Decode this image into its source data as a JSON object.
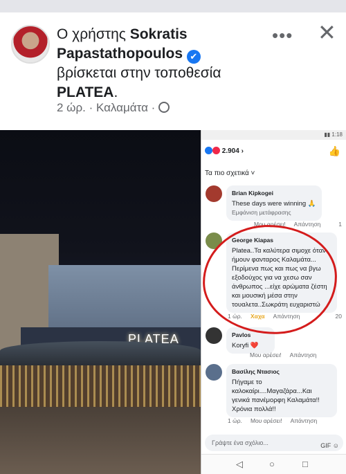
{
  "post": {
    "prefix": "Ο χρήστης ",
    "user_line1": "Sokratis",
    "user_line2": "Papastathopoulos",
    "verified_icon": "✔",
    "location_text": "βρίσκεται στην τοποθεσία",
    "location_name": "PLATEA",
    "time": "2 ώρ.",
    "place": "Καλαμάτα",
    "more_icon": "•••",
    "close_icon": "✕"
  },
  "photo": {
    "sign": "PLATEA"
  },
  "phone": {
    "reaction_count": "2.904",
    "reaction_arrow": "›",
    "sort_label": "Τα πιο σχετικά ˅",
    "comments": [
      {
        "name": "Brian Kipkogei",
        "text": "These days were winning 🙏",
        "sub": "Εμφάνιση μετάφρασης",
        "time": "",
        "like": "Μου αρέσει!",
        "reply": "Απάντηση",
        "count": "1"
      },
      {
        "name": "George Kiapas",
        "text": "Platea..Τα καλύτερα σιμοχε όταν ήμουν φανταρος Καλαμάτα... Περίμενα πως και πως να βγω εξοδούχος για να χεσω σαν άνθρωπος ...είχε αρώματα ζέστη και μουσική μέσα στην τουαλετα..Σωκράτη ευχαριστώ",
        "time": "1 ώρ.",
        "like": "Χαχα",
        "reply": "Απάντηση",
        "count": "20"
      },
      {
        "name": "Pavlos",
        "text": "Koryfi ❤️",
        "time": "",
        "like": "Μου αρέσει!",
        "reply": "Απάντηση",
        "count": ""
      },
      {
        "name": "Βασίλης Ντασιος",
        "text": "Πήγαμε το καλοκαίρι....Μαγαζάρα...Και γενικά πανέμορφη Καλαμάτα!! Χρόνια πολλά!!",
        "time": "1 ώρ.",
        "like": "Μου αρέσει!",
        "reply": "Απάντηση",
        "count": ""
      }
    ],
    "compose_placeholder": "Γράψτε ένα σχόλιο...",
    "compose_icons": "GIF ☺",
    "nav": [
      "◁",
      "○",
      "□"
    ]
  },
  "colors": {
    "accent": "#1877f2",
    "highlight": "#d41c1c"
  }
}
